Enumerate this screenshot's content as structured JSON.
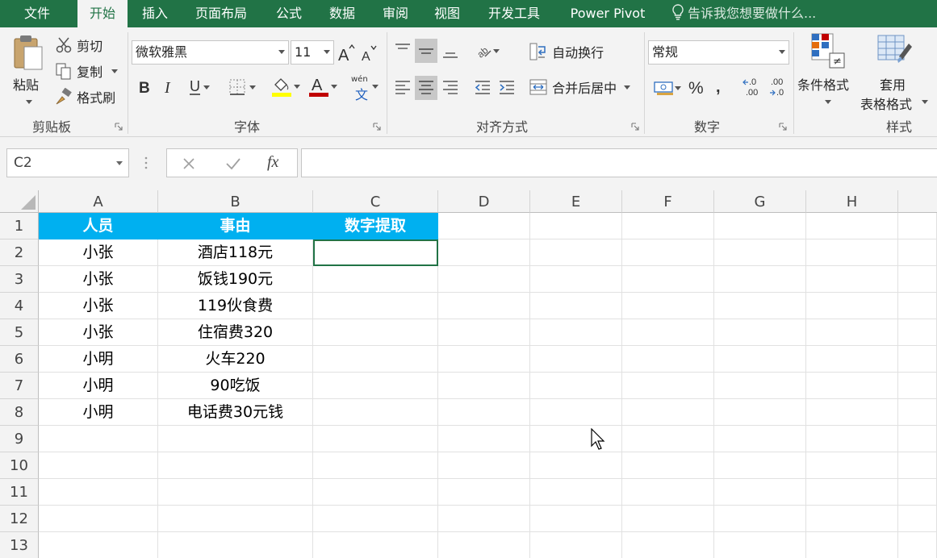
{
  "menu": {
    "tabs": [
      "文件",
      "开始",
      "插入",
      "页面布局",
      "公式",
      "数据",
      "审阅",
      "视图",
      "开发工具",
      "Power Pivot"
    ],
    "active": "开始",
    "tell_me": "告诉我您想要做什么..."
  },
  "ribbon": {
    "clipboard": {
      "paste": "粘贴",
      "cut": "剪切",
      "copy": "复制",
      "format_painter": "格式刷",
      "label": "剪贴板"
    },
    "font": {
      "name": "微软雅黑",
      "size": "11",
      "phonetic": "wén",
      "phonetic_char": "文",
      "label": "字体",
      "highlight_color": "#ffff00",
      "font_color": "#c00000"
    },
    "alignment": {
      "wrap_text": "自动换行",
      "merge_center": "合并后居中",
      "label": "对齐方式"
    },
    "number": {
      "format": "常规",
      "label": "数字",
      "dec_increase": ".0\n.00",
      "dec_decrease": ".00\n.0"
    },
    "styles": {
      "conditional": "条件格式",
      "table_line1": "套用",
      "table_line2": "表格格式",
      "label": "样式"
    }
  },
  "formula_bar": {
    "name_box": "C2",
    "fx": "fx",
    "value": ""
  },
  "sheet": {
    "columns": [
      "A",
      "B",
      "C",
      "D",
      "E",
      "F",
      "G",
      "H"
    ],
    "rows": [
      "1",
      "2",
      "3",
      "4",
      "5",
      "6",
      "7",
      "8",
      "9",
      "10",
      "11",
      "12",
      "13"
    ],
    "header_row": [
      "人员",
      "事由",
      "数字提取"
    ],
    "data": [
      [
        "小张",
        "酒店118元"
      ],
      [
        "小张",
        "饭钱190元"
      ],
      [
        "小张",
        "119伙食费"
      ],
      [
        "小张",
        "住宿费320"
      ],
      [
        "小明",
        "火车220"
      ],
      [
        "小明",
        "90吃饭"
      ],
      [
        "小明",
        "电话费30元钱"
      ]
    ],
    "active_cell": "C2",
    "header_fill": "#00b0f0"
  }
}
